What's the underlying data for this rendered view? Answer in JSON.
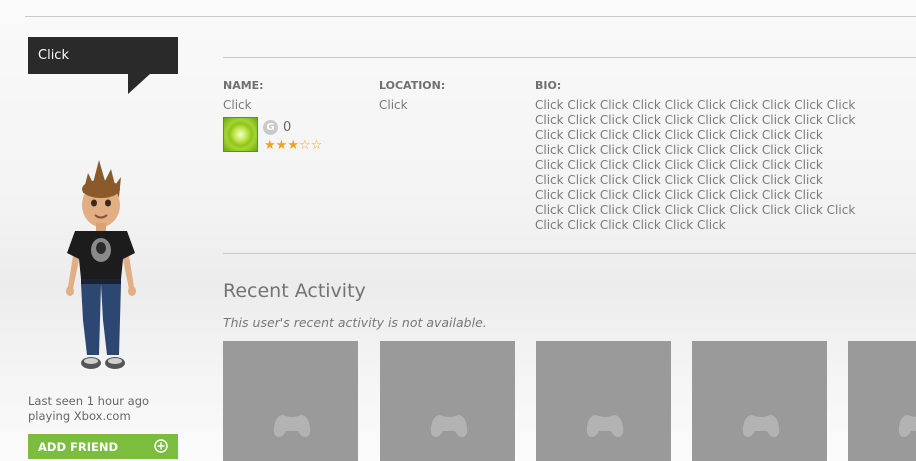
{
  "bubble": {
    "text": "Click"
  },
  "profile": {
    "name_label": "NAME:",
    "name_value": "Click",
    "location_label": "LOCATION:",
    "location_value": "Click",
    "bio_label": "BIO:",
    "bio_lines": [
      "Click Click Click Click Click Click Click Click Click Click",
      "Click Click Click Click Click Click  Click Click Click Click",
      "Click Click  Click Click Click Click  Click Click Click",
      "Click  Click Click Click Click Click Click Click Click",
      "Click Click Click Click Click Click  Click Click Click",
      "Click Click Click Click Click Click  Click Click Click",
      "Click Click Click Click Click Click  Click Click Click",
      "Click Click Click Click Click Click  Click Click Click Click",
      "Click  Click Click Click Click Click"
    ],
    "gamerscore_icon_letter": "G",
    "gamerscore": "0",
    "reputation_stars": 3,
    "reputation_max": 5
  },
  "avatar": {
    "last_seen": "Last seen 1 hour ago playing Xbox.com"
  },
  "add_friend": {
    "label": "ADD FRIEND"
  },
  "activity": {
    "title": "Recent Activity",
    "note": "This user's recent activity is not available.",
    "tile_icon": "controller-icon"
  },
  "colors": {
    "accent_green": "#7bbd3f",
    "bubble_bg": "#2a2a2a",
    "tile_gray": "#9a9a9a",
    "star_orange": "#f2a21f"
  }
}
